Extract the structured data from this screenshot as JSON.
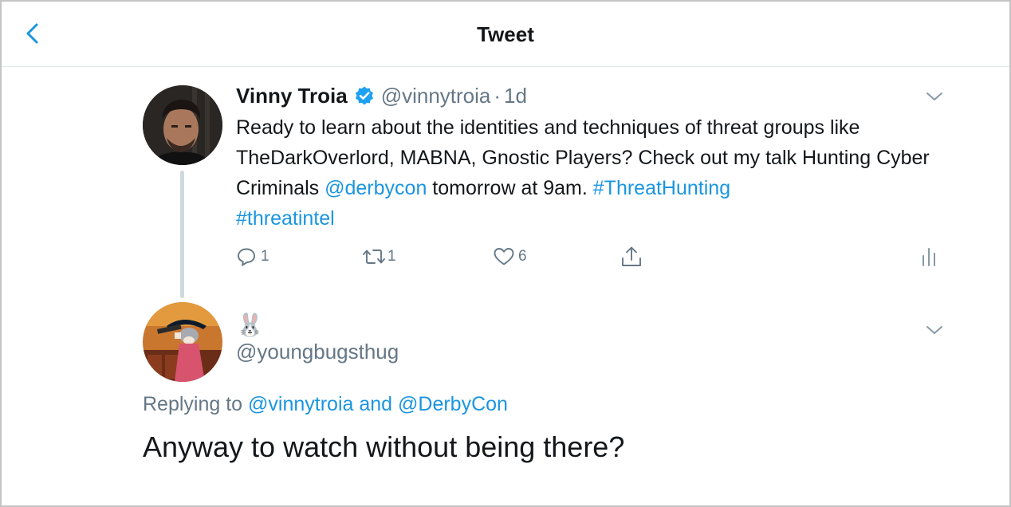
{
  "header": {
    "title": "Tweet",
    "back_icon": "chevron-left-icon"
  },
  "colors": {
    "link": "#1b95e0",
    "muted": "#657786",
    "text": "#14171a",
    "thread_line": "#cfd9de",
    "verified": "#1da1f2"
  },
  "tweet": {
    "name": "Vinny Troia",
    "verified_icon": "verified-badge-icon",
    "handle": "@vinnytroia",
    "separator": "·",
    "time": "1d",
    "text_part1": "Ready to learn about the identities and techniques of threat groups like TheDarkOverlord, MABNA, Gnostic Players? Check out my talk Hunting Cyber Criminals ",
    "mention": "@derbycon",
    "text_part2": " tomorrow at 9am. ",
    "hashtag1": "#ThreatHunting",
    "hashtag2": "#threatintel",
    "actions": {
      "reply_count": "1",
      "retweet_count": "1",
      "like_count": "6"
    }
  },
  "reply": {
    "display_name": "🐰",
    "handle": "@youngbugsthug",
    "replying_prefix": "Replying to ",
    "replying_user1": "@vinnytroia",
    "replying_and": " and ",
    "replying_user2": "@DerbyCon",
    "text": "Anyway to watch without being there?"
  }
}
